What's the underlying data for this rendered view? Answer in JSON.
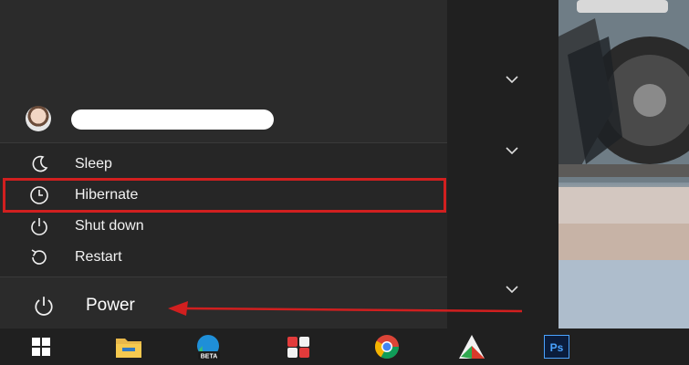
{
  "power_menu": {
    "items": [
      {
        "label": "Sleep",
        "icon": "moon-icon"
      },
      {
        "label": "Hibernate",
        "icon": "clock-icon"
      },
      {
        "label": "Shut down",
        "icon": "power-icon"
      },
      {
        "label": "Restart",
        "icon": "restart-icon"
      }
    ],
    "highlighted": "Hibernate"
  },
  "power_button": {
    "label": "Power",
    "icon": "power-icon"
  },
  "taskbar": {
    "icons": [
      "windows-start-icon",
      "file-explorer-icon",
      "edge-beta-icon",
      "app-icon",
      "chrome-icon",
      "app-icon",
      "photoshop-icon"
    ],
    "edge_badge": "BETA",
    "photoshop_label": "Ps"
  },
  "colors": {
    "highlight": "#d11f1f",
    "arrow": "#d11f1f",
    "pane": "#2b2b2b"
  }
}
